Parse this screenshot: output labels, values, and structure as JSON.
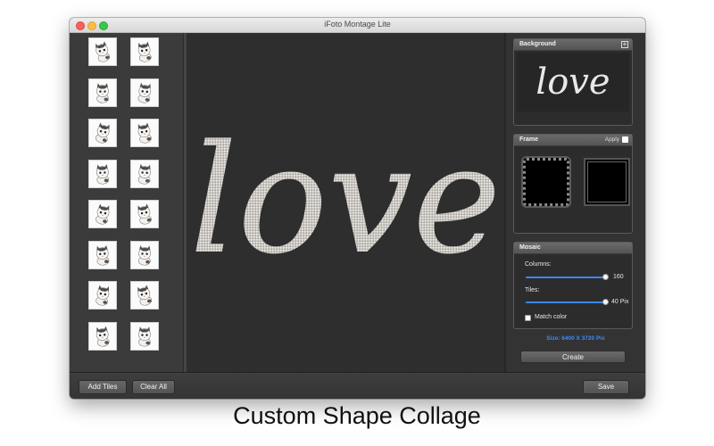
{
  "window": {
    "title": "iFoto Montage Lite"
  },
  "tiles": {
    "count": 16,
    "items": [
      "cat-tile-1",
      "cat-tile-2",
      "cat-tile-3",
      "cat-tile-4",
      "cat-tile-5",
      "cat-tile-6",
      "cat-tile-7",
      "cat-tile-8",
      "cat-tile-9",
      "cat-tile-10",
      "cat-tile-11",
      "cat-tile-12",
      "cat-tile-13",
      "cat-tile-14",
      "cat-tile-15",
      "cat-tile-16"
    ]
  },
  "canvas": {
    "shape_text": "love"
  },
  "background_panel": {
    "title": "Background",
    "add_icon": "plus-icon",
    "preview_text": "love"
  },
  "frame_panel": {
    "title": "Frame",
    "apply_label": "Apply"
  },
  "mosaic_panel": {
    "title": "Mosaic",
    "columns_label": "Columns:",
    "columns_value": "160",
    "tiles_label": "Tiles:",
    "tiles_value": "40 Pix",
    "match_color_label": "Match color"
  },
  "size_text": "Size: 6400 X 3720 Pix",
  "create_label": "Create",
  "bottom": {
    "add_tiles": "Add Tiles",
    "clear_all": "Clear All",
    "save": "Save"
  },
  "caption": "Custom Shape Collage",
  "colors": {
    "accent": "#3d86f5",
    "panel": "#333333",
    "canvas": "#2e2e2e"
  }
}
